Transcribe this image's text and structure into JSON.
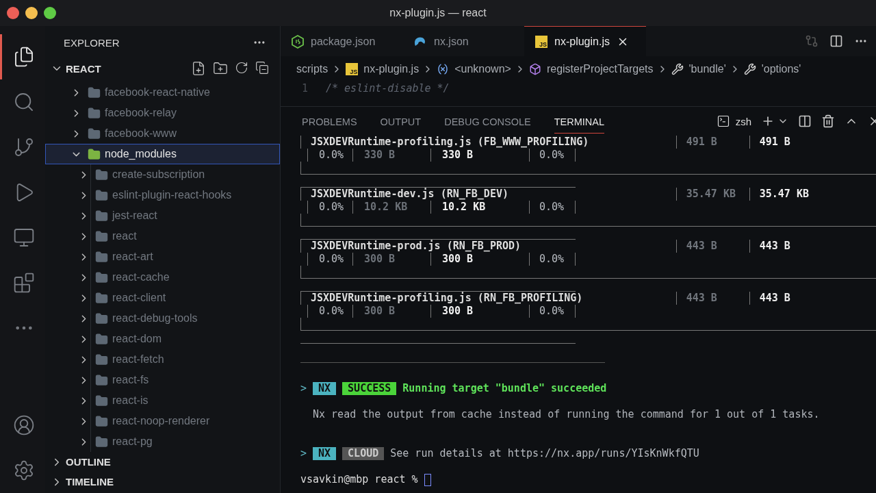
{
  "window": {
    "title": "nx-plugin.js — react"
  },
  "activity_bar": [
    {
      "kind": "explorer",
      "selected": true
    },
    {
      "kind": "search",
      "selected": false
    },
    {
      "kind": "source-control",
      "selected": false
    },
    {
      "kind": "run",
      "selected": false
    },
    {
      "kind": "remote",
      "selected": false
    },
    {
      "kind": "extensions",
      "selected": false
    },
    {
      "kind": "more",
      "selected": false
    },
    {
      "kind": "account",
      "selected": false
    },
    {
      "kind": "settings",
      "selected": false
    }
  ],
  "sidebar": {
    "title": "EXPLORER",
    "section": {
      "title": "REACT",
      "expanded": true
    },
    "tree": [
      {
        "name": "facebook-react-native",
        "expanded": false,
        "selected": false,
        "dimmed": true
      },
      {
        "name": "facebook-relay",
        "expanded": false,
        "selected": false,
        "dimmed": true
      },
      {
        "name": "facebook-www",
        "expanded": false,
        "selected": false,
        "dimmed": true
      },
      {
        "name": "node_modules",
        "expanded": true,
        "selected": true,
        "dimmed": false,
        "children": [
          {
            "name": "create-subscription",
            "expanded": false,
            "selected": false,
            "dimmed": true
          },
          {
            "name": "eslint-plugin-react-hooks",
            "expanded": false,
            "selected": false,
            "dimmed": true
          },
          {
            "name": "jest-react",
            "expanded": false,
            "selected": false,
            "dimmed": true
          },
          {
            "name": "react",
            "expanded": false,
            "selected": false,
            "dimmed": true
          },
          {
            "name": "react-art",
            "expanded": false,
            "selected": false,
            "dimmed": true
          },
          {
            "name": "react-cache",
            "expanded": false,
            "selected": false,
            "dimmed": true
          },
          {
            "name": "react-client",
            "expanded": false,
            "selected": false,
            "dimmed": true
          },
          {
            "name": "react-debug-tools",
            "expanded": false,
            "selected": false,
            "dimmed": true
          },
          {
            "name": "react-dom",
            "expanded": false,
            "selected": false,
            "dimmed": true
          },
          {
            "name": "react-fetch",
            "expanded": false,
            "selected": false,
            "dimmed": true
          },
          {
            "name": "react-fs",
            "expanded": false,
            "selected": false,
            "dimmed": true
          },
          {
            "name": "react-is",
            "expanded": false,
            "selected": false,
            "dimmed": true
          },
          {
            "name": "react-noop-renderer",
            "expanded": false,
            "selected": false,
            "dimmed": true
          },
          {
            "name": "react-pg",
            "expanded": false,
            "selected": false,
            "dimmed": true
          }
        ]
      }
    ],
    "bottom_sections": [
      {
        "title": "OUTLINE",
        "expanded": false
      },
      {
        "title": "TIMELINE",
        "expanded": false
      }
    ]
  },
  "tabs": [
    {
      "label": "package.json",
      "kind": "node",
      "selected": false
    },
    {
      "label": "nx.json",
      "kind": "nx",
      "selected": false
    },
    {
      "label": "nx-plugin.js",
      "kind": "js",
      "badge": "JS",
      "selected": true
    }
  ],
  "breadcrumb": [
    {
      "label": "scripts",
      "kind": "folder"
    },
    {
      "label": "nx-plugin.js",
      "kind": "js",
      "badge": "JS"
    },
    {
      "label": "<unknown>",
      "kind": "variable"
    },
    {
      "label": "registerProjectTargets",
      "kind": "method"
    },
    {
      "label": "'bundle'",
      "kind": "property"
    },
    {
      "label": "'options'",
      "kind": "property"
    }
  ],
  "code": [
    {
      "number": "1",
      "text": "/* eslint-disable */"
    }
  ],
  "panel": {
    "tabs": [
      {
        "label": "PROBLEMS",
        "selected": false
      },
      {
        "label": "OUTPUT",
        "selected": false
      },
      {
        "label": "DEBUG CONSOLE",
        "selected": false
      },
      {
        "label": "TERMINAL",
        "selected": true
      }
    ],
    "shell": "zsh"
  },
  "terminal": {
    "entries": [
      {
        "file": "JSXDEVRuntime-profiling.js",
        "bundle": "(FB_WWW_PROFILING)",
        "cells": [
          "0.0%",
          "330 B",
          "330 B",
          "0.0%"
        ],
        "prev_size": "491 B",
        "size": "491 B"
      },
      {
        "file": "JSXDEVRuntime-dev.js",
        "bundle": "(RN_FB_DEV)",
        "cells": [
          "0.0%",
          "10.2 KB",
          "10.2 KB",
          "0.0%"
        ],
        "prev_size": "35.47 KB",
        "size": "35.47 KB"
      },
      {
        "file": "JSXDEVRuntime-prod.js",
        "bundle": "(RN_FB_PROD)",
        "cells": [
          "0.0%",
          "300 B",
          "300 B",
          "0.0%"
        ],
        "prev_size": "443 B",
        "size": "443 B"
      },
      {
        "file": "JSXDEVRuntime-profiling.js",
        "bundle": "(RN_FB_PROFILING)",
        "cells": [
          "0.0%",
          "300 B",
          "300 B",
          "0.0%"
        ],
        "prev_size": "443 B",
        "size": "443 B"
      }
    ],
    "success": {
      "prompt": ">",
      "tags": [
        {
          "text": "NX",
          "kind": "nx"
        },
        {
          "text": "SUCCESS",
          "kind": "success"
        }
      ],
      "message": "Running target \"bundle\" succeeded"
    },
    "note": "Nx read the output from cache instead of running the command for 1 out of 1 tasks.",
    "cloud": {
      "prompt": ">",
      "tags": [
        {
          "text": "NX",
          "kind": "nx"
        },
        {
          "text": "CLOUD",
          "kind": "cloud"
        }
      ],
      "message": "See run details at https://nx.app/runs/YIsKnWkfQTU"
    },
    "prompt": "vsavkin@mbp react %"
  }
}
